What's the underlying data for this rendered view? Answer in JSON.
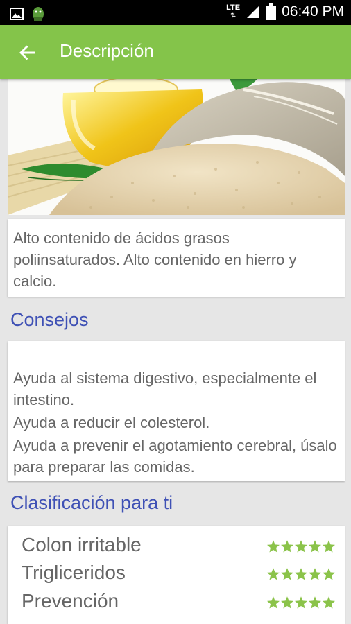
{
  "status_bar": {
    "time": "06:40 PM",
    "network": "LTE"
  },
  "app_bar": {
    "title": "Descripción",
    "back_icon": "arrow-back-icon"
  },
  "hero": {
    "description": "sesame seeds and oil bottle photo"
  },
  "description": {
    "text": "Alto contenido de ácidos grasos poliinsaturados. Alto contenido en hierro y calcio."
  },
  "consejos": {
    "heading": "Consejos",
    "tips": [
      "Ayuda al sistema digestivo, especialmente el intestino.",
      "Ayuda  a reducir el colesterol.",
      "Ayuda a prevenir el agotamiento cerebral, úsalo para preparar las comidas."
    ]
  },
  "clasificacion": {
    "heading": "Clasificación para ti",
    "rows": [
      {
        "label": "Colon irritable",
        "stars": 5,
        "max": 5
      },
      {
        "label": "Trigliceridos",
        "stars": 5,
        "max": 5
      },
      {
        "label": "Prevención",
        "stars": 5,
        "max": 5
      }
    ],
    "star_color": "#8bc34a"
  },
  "colors": {
    "app_bar": "#84c44a",
    "heading": "#3f51b5",
    "text": "#666666",
    "background": "#e6e6e6"
  }
}
